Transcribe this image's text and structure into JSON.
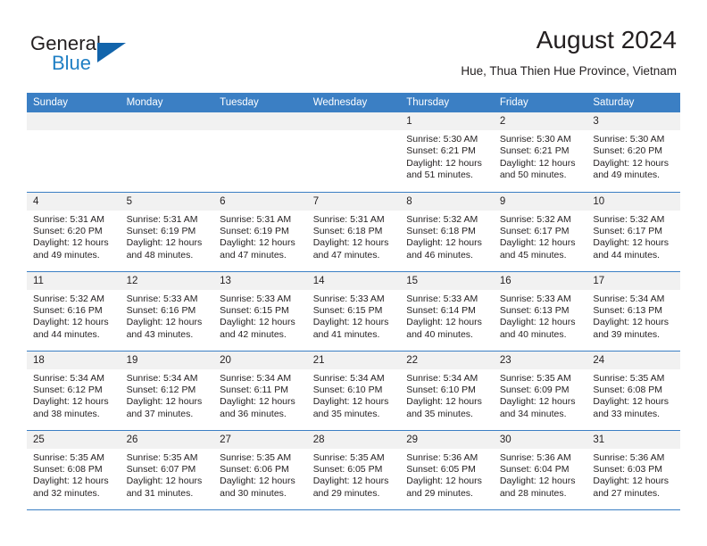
{
  "brand": {
    "name_part1": "General",
    "name_part2": "Blue",
    "logo_icon": "triangle-icon"
  },
  "header": {
    "title": "August 2024",
    "subtitle": "Hue, Thua Thien Hue Province, Vietnam"
  },
  "calendar": {
    "weekday_headers": [
      "Sunday",
      "Monday",
      "Tuesday",
      "Wednesday",
      "Thursday",
      "Friday",
      "Saturday"
    ],
    "accent_color": "#3b7fc4",
    "daynum_band_color": "#f1f1f1",
    "weeks": [
      [
        {
          "day": "",
          "blank": true,
          "sunrise": "",
          "sunset": "",
          "daylight_line1": "",
          "daylight_line2": ""
        },
        {
          "day": "",
          "blank": true,
          "sunrise": "",
          "sunset": "",
          "daylight_line1": "",
          "daylight_line2": ""
        },
        {
          "day": "",
          "blank": true,
          "sunrise": "",
          "sunset": "",
          "daylight_line1": "",
          "daylight_line2": ""
        },
        {
          "day": "",
          "blank": true,
          "sunrise": "",
          "sunset": "",
          "daylight_line1": "",
          "daylight_line2": ""
        },
        {
          "day": "1",
          "blank": false,
          "sunrise": "Sunrise: 5:30 AM",
          "sunset": "Sunset: 6:21 PM",
          "daylight_line1": "Daylight: 12 hours",
          "daylight_line2": "and 51 minutes."
        },
        {
          "day": "2",
          "blank": false,
          "sunrise": "Sunrise: 5:30 AM",
          "sunset": "Sunset: 6:21 PM",
          "daylight_line1": "Daylight: 12 hours",
          "daylight_line2": "and 50 minutes."
        },
        {
          "day": "3",
          "blank": false,
          "sunrise": "Sunrise: 5:30 AM",
          "sunset": "Sunset: 6:20 PM",
          "daylight_line1": "Daylight: 12 hours",
          "daylight_line2": "and 49 minutes."
        }
      ],
      [
        {
          "day": "4",
          "blank": false,
          "sunrise": "Sunrise: 5:31 AM",
          "sunset": "Sunset: 6:20 PM",
          "daylight_line1": "Daylight: 12 hours",
          "daylight_line2": "and 49 minutes."
        },
        {
          "day": "5",
          "blank": false,
          "sunrise": "Sunrise: 5:31 AM",
          "sunset": "Sunset: 6:19 PM",
          "daylight_line1": "Daylight: 12 hours",
          "daylight_line2": "and 48 minutes."
        },
        {
          "day": "6",
          "blank": false,
          "sunrise": "Sunrise: 5:31 AM",
          "sunset": "Sunset: 6:19 PM",
          "daylight_line1": "Daylight: 12 hours",
          "daylight_line2": "and 47 minutes."
        },
        {
          "day": "7",
          "blank": false,
          "sunrise": "Sunrise: 5:31 AM",
          "sunset": "Sunset: 6:18 PM",
          "daylight_line1": "Daylight: 12 hours",
          "daylight_line2": "and 47 minutes."
        },
        {
          "day": "8",
          "blank": false,
          "sunrise": "Sunrise: 5:32 AM",
          "sunset": "Sunset: 6:18 PM",
          "daylight_line1": "Daylight: 12 hours",
          "daylight_line2": "and 46 minutes."
        },
        {
          "day": "9",
          "blank": false,
          "sunrise": "Sunrise: 5:32 AM",
          "sunset": "Sunset: 6:17 PM",
          "daylight_line1": "Daylight: 12 hours",
          "daylight_line2": "and 45 minutes."
        },
        {
          "day": "10",
          "blank": false,
          "sunrise": "Sunrise: 5:32 AM",
          "sunset": "Sunset: 6:17 PM",
          "daylight_line1": "Daylight: 12 hours",
          "daylight_line2": "and 44 minutes."
        }
      ],
      [
        {
          "day": "11",
          "blank": false,
          "sunrise": "Sunrise: 5:32 AM",
          "sunset": "Sunset: 6:16 PM",
          "daylight_line1": "Daylight: 12 hours",
          "daylight_line2": "and 44 minutes."
        },
        {
          "day": "12",
          "blank": false,
          "sunrise": "Sunrise: 5:33 AM",
          "sunset": "Sunset: 6:16 PM",
          "daylight_line1": "Daylight: 12 hours",
          "daylight_line2": "and 43 minutes."
        },
        {
          "day": "13",
          "blank": false,
          "sunrise": "Sunrise: 5:33 AM",
          "sunset": "Sunset: 6:15 PM",
          "daylight_line1": "Daylight: 12 hours",
          "daylight_line2": "and 42 minutes."
        },
        {
          "day": "14",
          "blank": false,
          "sunrise": "Sunrise: 5:33 AM",
          "sunset": "Sunset: 6:15 PM",
          "daylight_line1": "Daylight: 12 hours",
          "daylight_line2": "and 41 minutes."
        },
        {
          "day": "15",
          "blank": false,
          "sunrise": "Sunrise: 5:33 AM",
          "sunset": "Sunset: 6:14 PM",
          "daylight_line1": "Daylight: 12 hours",
          "daylight_line2": "and 40 minutes."
        },
        {
          "day": "16",
          "blank": false,
          "sunrise": "Sunrise: 5:33 AM",
          "sunset": "Sunset: 6:13 PM",
          "daylight_line1": "Daylight: 12 hours",
          "daylight_line2": "and 40 minutes."
        },
        {
          "day": "17",
          "blank": false,
          "sunrise": "Sunrise: 5:34 AM",
          "sunset": "Sunset: 6:13 PM",
          "daylight_line1": "Daylight: 12 hours",
          "daylight_line2": "and 39 minutes."
        }
      ],
      [
        {
          "day": "18",
          "blank": false,
          "sunrise": "Sunrise: 5:34 AM",
          "sunset": "Sunset: 6:12 PM",
          "daylight_line1": "Daylight: 12 hours",
          "daylight_line2": "and 38 minutes."
        },
        {
          "day": "19",
          "blank": false,
          "sunrise": "Sunrise: 5:34 AM",
          "sunset": "Sunset: 6:12 PM",
          "daylight_line1": "Daylight: 12 hours",
          "daylight_line2": "and 37 minutes."
        },
        {
          "day": "20",
          "blank": false,
          "sunrise": "Sunrise: 5:34 AM",
          "sunset": "Sunset: 6:11 PM",
          "daylight_line1": "Daylight: 12 hours",
          "daylight_line2": "and 36 minutes."
        },
        {
          "day": "21",
          "blank": false,
          "sunrise": "Sunrise: 5:34 AM",
          "sunset": "Sunset: 6:10 PM",
          "daylight_line1": "Daylight: 12 hours",
          "daylight_line2": "and 35 minutes."
        },
        {
          "day": "22",
          "blank": false,
          "sunrise": "Sunrise: 5:34 AM",
          "sunset": "Sunset: 6:10 PM",
          "daylight_line1": "Daylight: 12 hours",
          "daylight_line2": "and 35 minutes."
        },
        {
          "day": "23",
          "blank": false,
          "sunrise": "Sunrise: 5:35 AM",
          "sunset": "Sunset: 6:09 PM",
          "daylight_line1": "Daylight: 12 hours",
          "daylight_line2": "and 34 minutes."
        },
        {
          "day": "24",
          "blank": false,
          "sunrise": "Sunrise: 5:35 AM",
          "sunset": "Sunset: 6:08 PM",
          "daylight_line1": "Daylight: 12 hours",
          "daylight_line2": "and 33 minutes."
        }
      ],
      [
        {
          "day": "25",
          "blank": false,
          "sunrise": "Sunrise: 5:35 AM",
          "sunset": "Sunset: 6:08 PM",
          "daylight_line1": "Daylight: 12 hours",
          "daylight_line2": "and 32 minutes."
        },
        {
          "day": "26",
          "blank": false,
          "sunrise": "Sunrise: 5:35 AM",
          "sunset": "Sunset: 6:07 PM",
          "daylight_line1": "Daylight: 12 hours",
          "daylight_line2": "and 31 minutes."
        },
        {
          "day": "27",
          "blank": false,
          "sunrise": "Sunrise: 5:35 AM",
          "sunset": "Sunset: 6:06 PM",
          "daylight_line1": "Daylight: 12 hours",
          "daylight_line2": "and 30 minutes."
        },
        {
          "day": "28",
          "blank": false,
          "sunrise": "Sunrise: 5:35 AM",
          "sunset": "Sunset: 6:05 PM",
          "daylight_line1": "Daylight: 12 hours",
          "daylight_line2": "and 29 minutes."
        },
        {
          "day": "29",
          "blank": false,
          "sunrise": "Sunrise: 5:36 AM",
          "sunset": "Sunset: 6:05 PM",
          "daylight_line1": "Daylight: 12 hours",
          "daylight_line2": "and 29 minutes."
        },
        {
          "day": "30",
          "blank": false,
          "sunrise": "Sunrise: 5:36 AM",
          "sunset": "Sunset: 6:04 PM",
          "daylight_line1": "Daylight: 12 hours",
          "daylight_line2": "and 28 minutes."
        },
        {
          "day": "31",
          "blank": false,
          "sunrise": "Sunrise: 5:36 AM",
          "sunset": "Sunset: 6:03 PM",
          "daylight_line1": "Daylight: 12 hours",
          "daylight_line2": "and 27 minutes."
        }
      ]
    ]
  }
}
